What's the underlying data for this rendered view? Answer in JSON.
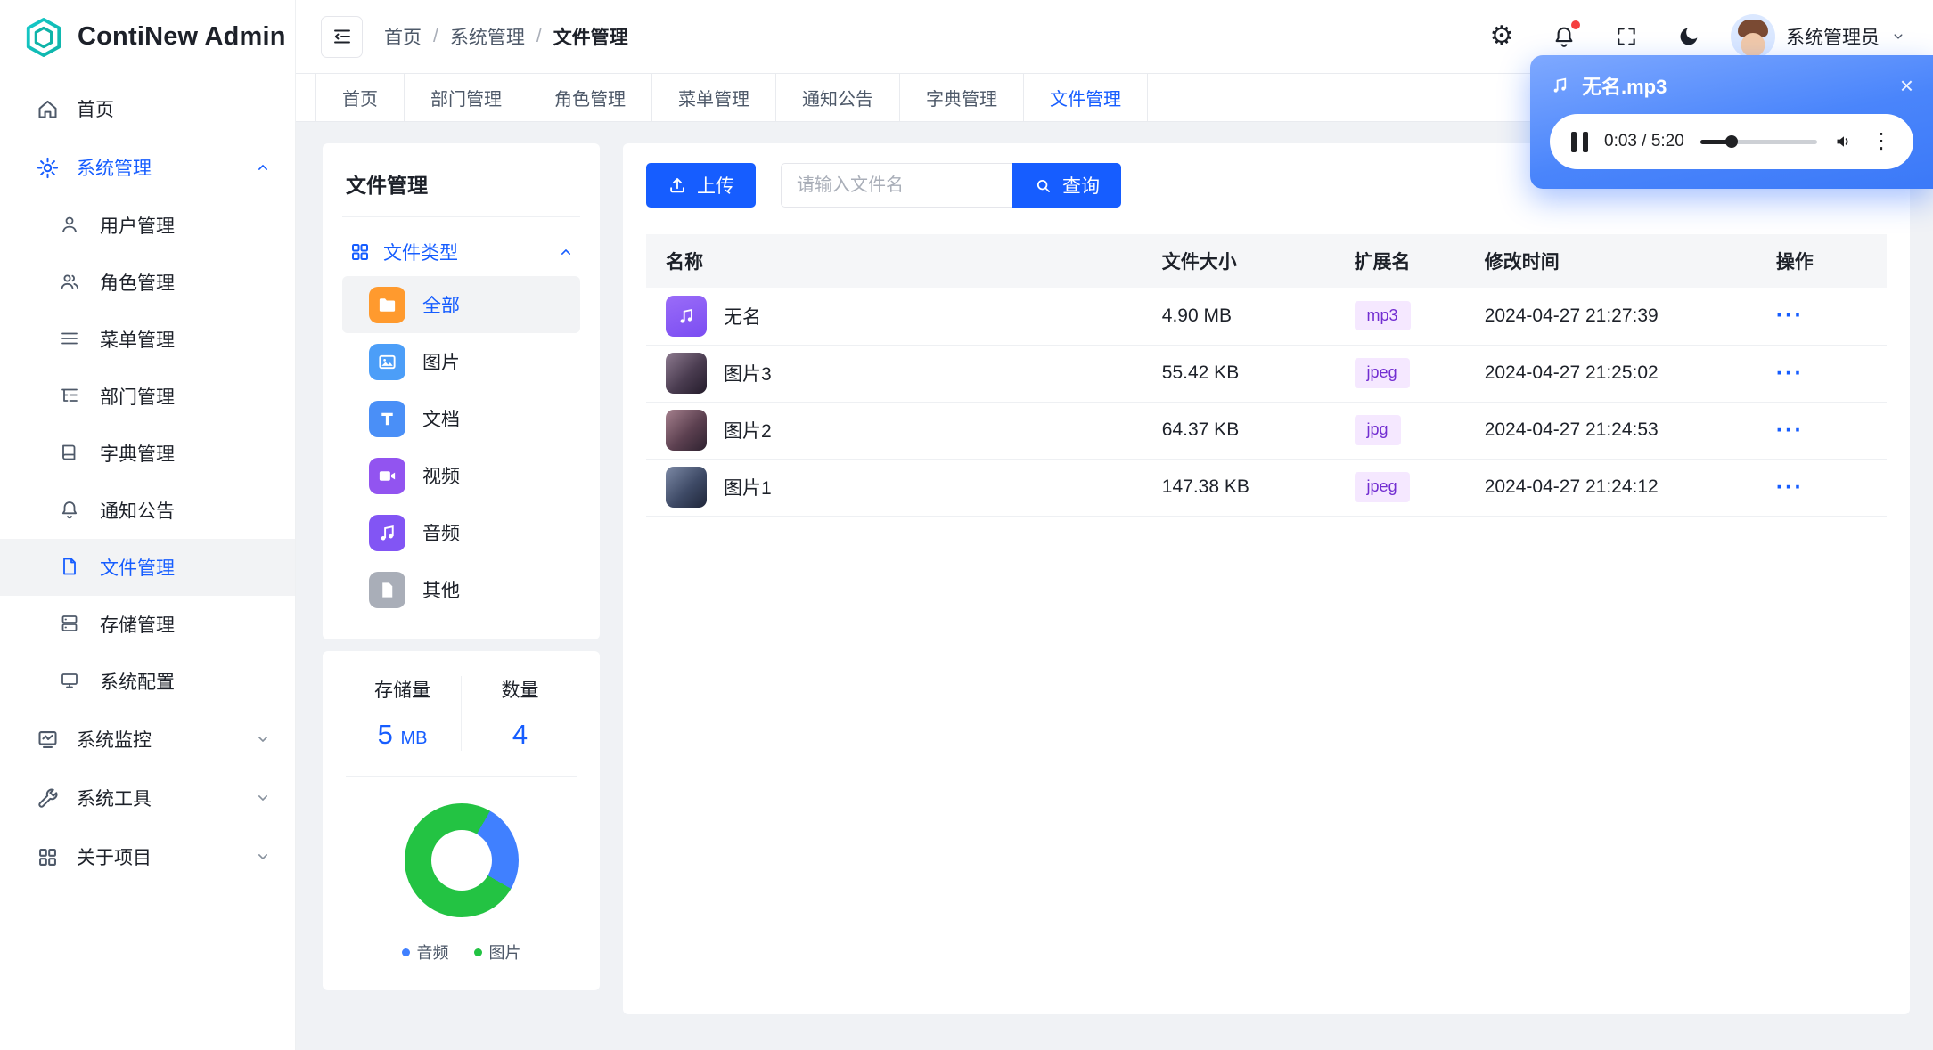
{
  "theme": {
    "primary": "#165DFF",
    "tag_bg": "#F5E8FF",
    "tag_text": "#722ED1"
  },
  "icons": {
    "gear": "⚙",
    "ellipsis": "···",
    "kebab": "⋮",
    "close": "×"
  },
  "app": {
    "title": "ContiNew Admin"
  },
  "header": {
    "breadcrumb": [
      "首页",
      "系统管理",
      "文件管理"
    ],
    "user_name": "系统管理员"
  },
  "tabs": [
    {
      "label": "首页",
      "active": false
    },
    {
      "label": "部门管理",
      "active": false
    },
    {
      "label": "角色管理",
      "active": false
    },
    {
      "label": "菜单管理",
      "active": false
    },
    {
      "label": "通知公告",
      "active": false
    },
    {
      "label": "字典管理",
      "active": false
    },
    {
      "label": "文件管理",
      "active": true
    }
  ],
  "sidebar": {
    "items": [
      {
        "label": "首页"
      },
      {
        "label": "系统管理",
        "expanded": true,
        "children": [
          {
            "label": "用户管理"
          },
          {
            "label": "角色管理"
          },
          {
            "label": "菜单管理"
          },
          {
            "label": "部门管理"
          },
          {
            "label": "字典管理"
          },
          {
            "label": "通知公告"
          },
          {
            "label": "文件管理",
            "active": true
          },
          {
            "label": "存储管理"
          },
          {
            "label": "系统配置"
          }
        ]
      },
      {
        "label": "系统监控"
      },
      {
        "label": "系统工具"
      },
      {
        "label": "关于项目"
      }
    ]
  },
  "file_panel": {
    "title": "文件管理",
    "group_label": "文件类型",
    "types": [
      {
        "label": "全部",
        "color": "#FF9A2E",
        "active": true
      },
      {
        "label": "图片",
        "color": "#4C9EF8",
        "active": false
      },
      {
        "label": "文档",
        "color": "#4A8FF7",
        "active": false
      },
      {
        "label": "视频",
        "color": "#9254F0",
        "active": false
      },
      {
        "label": "音频",
        "color": "#8255F4",
        "active": false
      },
      {
        "label": "其他",
        "color": "#A9AEB8",
        "active": false
      }
    ],
    "stats": {
      "storage_label": "存储量",
      "storage_value": "5",
      "storage_unit": "MB",
      "count_label": "数量",
      "count_value": "4"
    }
  },
  "toolbar": {
    "upload": "上传",
    "search_placeholder": "请输入文件名",
    "query": "查询"
  },
  "table": {
    "columns": [
      "名称",
      "文件大小",
      "扩展名",
      "修改时间",
      "操作"
    ],
    "rows": [
      {
        "name": "无名",
        "size": "4.90 MB",
        "ext": "mp3",
        "time": "2024-04-27 21:27:39"
      },
      {
        "name": "图片3",
        "size": "55.42 KB",
        "ext": "jpeg",
        "time": "2024-04-27 21:25:02"
      },
      {
        "name": "图片2",
        "size": "64.37 KB",
        "ext": "jpg",
        "time": "2024-04-27 21:24:53"
      },
      {
        "name": "图片1",
        "size": "147.38 KB",
        "ext": "jpeg",
        "time": "2024-04-27 21:24:12"
      }
    ]
  },
  "player": {
    "title": "无名.mp3",
    "time": "0:03 / 5:20"
  },
  "chart_data": {
    "type": "pie",
    "categories": [
      "音频",
      "图片"
    ],
    "values": [
      1,
      3
    ],
    "colors": [
      "#4080FF",
      "#23C343"
    ],
    "legend_position": "bottom"
  }
}
